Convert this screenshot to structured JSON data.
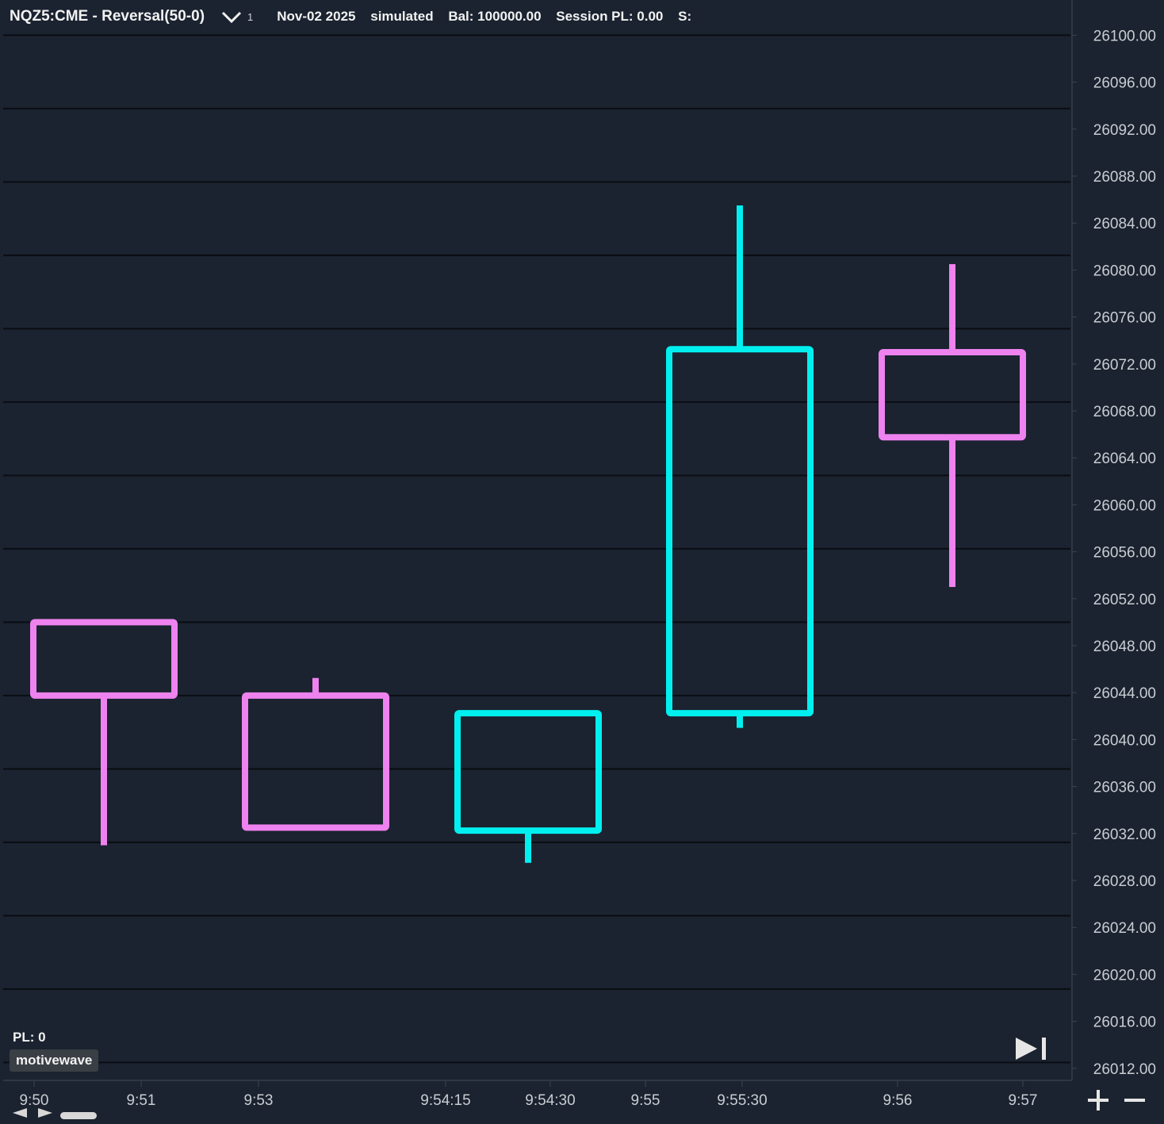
{
  "header": {
    "title": "NQZ5:CME - Reversal(50-0)",
    "dropdown_count": "1",
    "date": "Nov-02 2025",
    "mode": "simulated",
    "balance": "Bal: 100000.00",
    "session_pl": "Session PL: 0.00",
    "s_label": "S:"
  },
  "footer": {
    "pl": "PL: 0",
    "logo": "motivewave"
  },
  "colors": {
    "background": "#1b2330",
    "grid": "#0a0d12",
    "bull": "#00f0f0",
    "bear": "#ee82ee",
    "axis_text": "#c9cdd2"
  },
  "icons": {
    "dropdown": "chevron-down-icon",
    "skip_to_end": "skip-to-end-icon",
    "zoom_in": "plus-icon",
    "zoom_out": "minus-icon",
    "scroll_left": "arrow-left-icon",
    "scroll_right": "arrow-right-icon"
  },
  "chart_data": {
    "type": "candlestick",
    "ylim": [
      26010.5,
      26100.5
    ],
    "y_ticks": [
      "26100.00",
      "26096.00",
      "26092.00",
      "26088.00",
      "26084.00",
      "26080.00",
      "26076.00",
      "26072.00",
      "26068.00",
      "26064.00",
      "26060.00",
      "26056.00",
      "26052.00",
      "26048.00",
      "26044.00",
      "26040.00",
      "26036.00",
      "26032.00",
      "26028.00",
      "26024.00",
      "26020.00",
      "26016.00",
      "26012.00"
    ],
    "x_ticks": [
      "9:50",
      "9:51",
      "9:53",
      "9:54:15",
      "9:54:30",
      "9:55",
      "9:55:30",
      "9:56",
      "9:57"
    ],
    "grid": true,
    "candles": [
      {
        "open": 26050.0,
        "high": 26050.25,
        "low": 26031.0,
        "close": 26043.75
      },
      {
        "open": 26043.75,
        "high": 26045.25,
        "low": 26032.5,
        "close": 26032.5
      },
      {
        "open": 26032.25,
        "high": 26042.25,
        "low": 26029.5,
        "close": 26042.25
      },
      {
        "open": 26042.25,
        "high": 26085.5,
        "low": 26041.0,
        "close": 26073.25
      },
      {
        "open": 26073.0,
        "high": 26080.5,
        "low": 26053.0,
        "close": 26065.75
      }
    ]
  }
}
